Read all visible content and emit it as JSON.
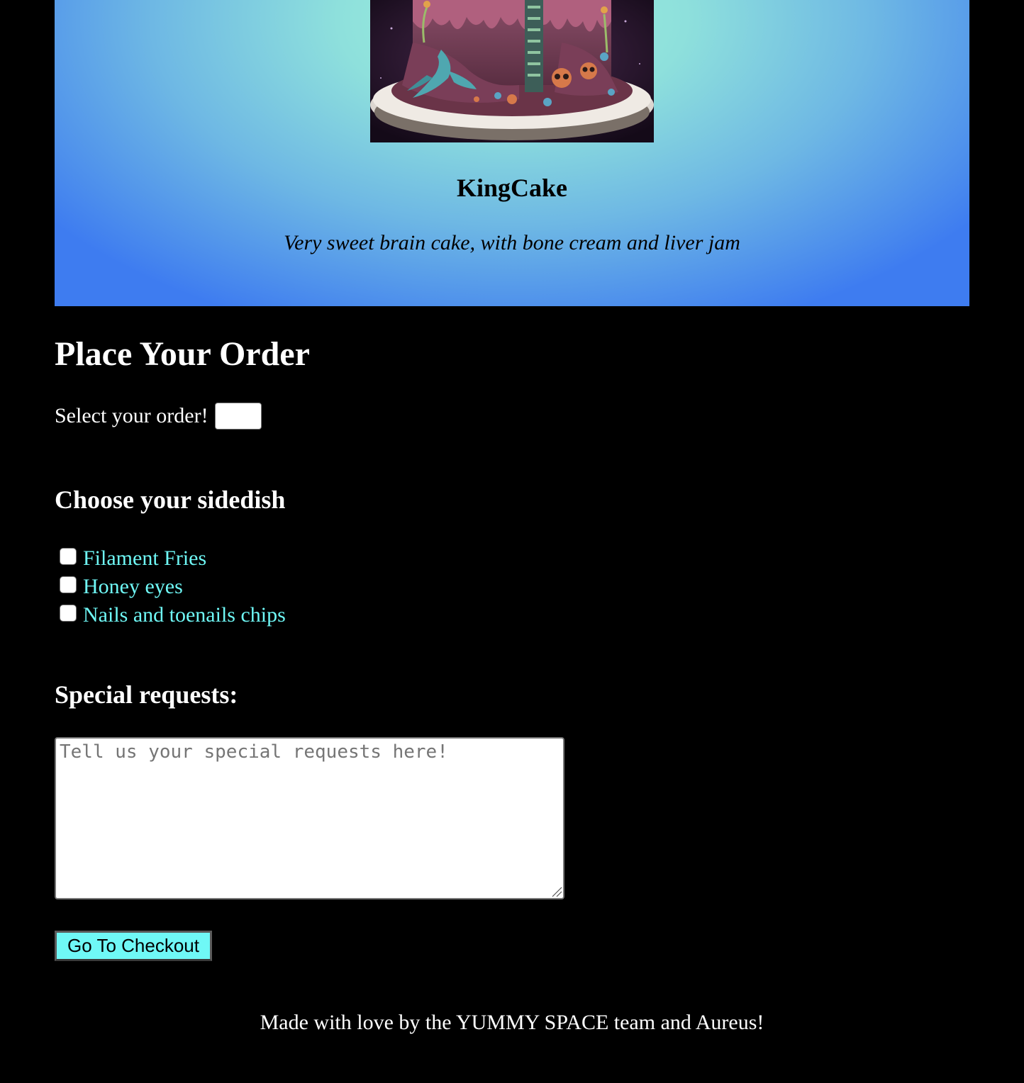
{
  "hero": {
    "image_alt": "alien brain cake",
    "product_name": "KingCake",
    "description": "Very sweet brain cake, with bone cream and liver jam"
  },
  "order": {
    "heading": "Place Your Order",
    "select_label": "Select your order!",
    "select_value": ""
  },
  "sidedish": {
    "heading": "Choose your sidedish",
    "items": [
      {
        "label": "Filament Fries",
        "checked": false
      },
      {
        "label": "Honey eyes",
        "checked": false
      },
      {
        "label": "Nails and toenails chips",
        "checked": false
      }
    ]
  },
  "special_requests": {
    "heading": "Special requests:",
    "placeholder": "Tell us your special requests here!",
    "value": ""
  },
  "checkout": {
    "button_label": "Go To Checkout"
  },
  "footer": {
    "text": "Made with love by the YUMMY SPACE team and Aureus!"
  },
  "colors": {
    "accent": "#6ff8f6",
    "background": "#000000",
    "hero_gradient_light": "#9ef3da",
    "hero_gradient_dark": "#3e7cf0"
  }
}
